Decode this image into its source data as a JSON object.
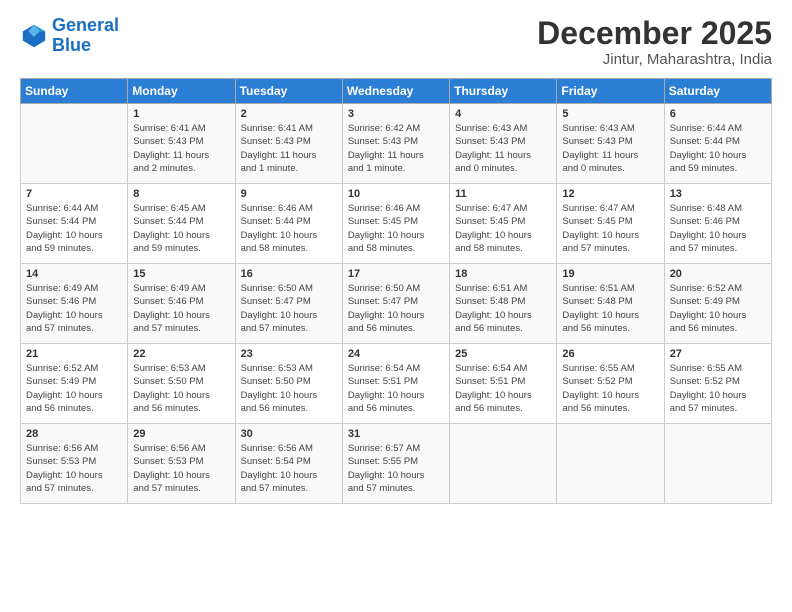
{
  "header": {
    "logo_line1": "General",
    "logo_line2": "Blue",
    "month": "December 2025",
    "location": "Jintur, Maharashtra, India"
  },
  "days_of_week": [
    "Sunday",
    "Monday",
    "Tuesday",
    "Wednesday",
    "Thursday",
    "Friday",
    "Saturday"
  ],
  "weeks": [
    [
      {
        "day": "",
        "info": ""
      },
      {
        "day": "1",
        "info": "Sunrise: 6:41 AM\nSunset: 5:43 PM\nDaylight: 11 hours\nand 2 minutes."
      },
      {
        "day": "2",
        "info": "Sunrise: 6:41 AM\nSunset: 5:43 PM\nDaylight: 11 hours\nand 1 minute."
      },
      {
        "day": "3",
        "info": "Sunrise: 6:42 AM\nSunset: 5:43 PM\nDaylight: 11 hours\nand 1 minute."
      },
      {
        "day": "4",
        "info": "Sunrise: 6:43 AM\nSunset: 5:43 PM\nDaylight: 11 hours\nand 0 minutes."
      },
      {
        "day": "5",
        "info": "Sunrise: 6:43 AM\nSunset: 5:43 PM\nDaylight: 11 hours\nand 0 minutes."
      },
      {
        "day": "6",
        "info": "Sunrise: 6:44 AM\nSunset: 5:44 PM\nDaylight: 10 hours\nand 59 minutes."
      }
    ],
    [
      {
        "day": "7",
        "info": "Sunrise: 6:44 AM\nSunset: 5:44 PM\nDaylight: 10 hours\nand 59 minutes."
      },
      {
        "day": "8",
        "info": "Sunrise: 6:45 AM\nSunset: 5:44 PM\nDaylight: 10 hours\nand 59 minutes."
      },
      {
        "day": "9",
        "info": "Sunrise: 6:46 AM\nSunset: 5:44 PM\nDaylight: 10 hours\nand 58 minutes."
      },
      {
        "day": "10",
        "info": "Sunrise: 6:46 AM\nSunset: 5:45 PM\nDaylight: 10 hours\nand 58 minutes."
      },
      {
        "day": "11",
        "info": "Sunrise: 6:47 AM\nSunset: 5:45 PM\nDaylight: 10 hours\nand 58 minutes."
      },
      {
        "day": "12",
        "info": "Sunrise: 6:47 AM\nSunset: 5:45 PM\nDaylight: 10 hours\nand 57 minutes."
      },
      {
        "day": "13",
        "info": "Sunrise: 6:48 AM\nSunset: 5:46 PM\nDaylight: 10 hours\nand 57 minutes."
      }
    ],
    [
      {
        "day": "14",
        "info": "Sunrise: 6:49 AM\nSunset: 5:46 PM\nDaylight: 10 hours\nand 57 minutes."
      },
      {
        "day": "15",
        "info": "Sunrise: 6:49 AM\nSunset: 5:46 PM\nDaylight: 10 hours\nand 57 minutes."
      },
      {
        "day": "16",
        "info": "Sunrise: 6:50 AM\nSunset: 5:47 PM\nDaylight: 10 hours\nand 57 minutes."
      },
      {
        "day": "17",
        "info": "Sunrise: 6:50 AM\nSunset: 5:47 PM\nDaylight: 10 hours\nand 56 minutes."
      },
      {
        "day": "18",
        "info": "Sunrise: 6:51 AM\nSunset: 5:48 PM\nDaylight: 10 hours\nand 56 minutes."
      },
      {
        "day": "19",
        "info": "Sunrise: 6:51 AM\nSunset: 5:48 PM\nDaylight: 10 hours\nand 56 minutes."
      },
      {
        "day": "20",
        "info": "Sunrise: 6:52 AM\nSunset: 5:49 PM\nDaylight: 10 hours\nand 56 minutes."
      }
    ],
    [
      {
        "day": "21",
        "info": "Sunrise: 6:52 AM\nSunset: 5:49 PM\nDaylight: 10 hours\nand 56 minutes."
      },
      {
        "day": "22",
        "info": "Sunrise: 6:53 AM\nSunset: 5:50 PM\nDaylight: 10 hours\nand 56 minutes."
      },
      {
        "day": "23",
        "info": "Sunrise: 6:53 AM\nSunset: 5:50 PM\nDaylight: 10 hours\nand 56 minutes."
      },
      {
        "day": "24",
        "info": "Sunrise: 6:54 AM\nSunset: 5:51 PM\nDaylight: 10 hours\nand 56 minutes."
      },
      {
        "day": "25",
        "info": "Sunrise: 6:54 AM\nSunset: 5:51 PM\nDaylight: 10 hours\nand 56 minutes."
      },
      {
        "day": "26",
        "info": "Sunrise: 6:55 AM\nSunset: 5:52 PM\nDaylight: 10 hours\nand 56 minutes."
      },
      {
        "day": "27",
        "info": "Sunrise: 6:55 AM\nSunset: 5:52 PM\nDaylight: 10 hours\nand 57 minutes."
      }
    ],
    [
      {
        "day": "28",
        "info": "Sunrise: 6:56 AM\nSunset: 5:53 PM\nDaylight: 10 hours\nand 57 minutes."
      },
      {
        "day": "29",
        "info": "Sunrise: 6:56 AM\nSunset: 5:53 PM\nDaylight: 10 hours\nand 57 minutes."
      },
      {
        "day": "30",
        "info": "Sunrise: 6:56 AM\nSunset: 5:54 PM\nDaylight: 10 hours\nand 57 minutes."
      },
      {
        "day": "31",
        "info": "Sunrise: 6:57 AM\nSunset: 5:55 PM\nDaylight: 10 hours\nand 57 minutes."
      },
      {
        "day": "",
        "info": ""
      },
      {
        "day": "",
        "info": ""
      },
      {
        "day": "",
        "info": ""
      }
    ]
  ]
}
